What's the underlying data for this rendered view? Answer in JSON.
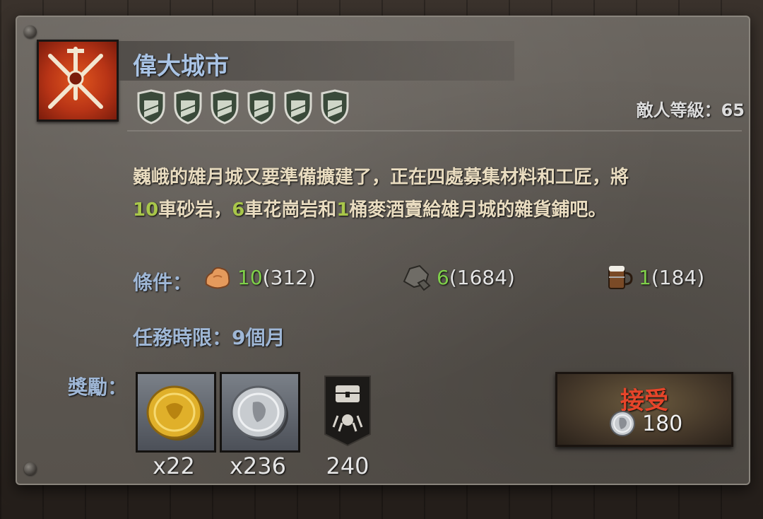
{
  "quest": {
    "title": "偉大城市",
    "enemy_level_label": "敵人等級：65",
    "difficulty_shields": 6,
    "description_line1": "巍峨的雄月城又要準備擴建了，正在四處募集材料和工匠，將",
    "description_line2_a": "10",
    "description_line2_b": "車砂岩，",
    "description_line2_c": "6",
    "description_line2_d": "車花崗岩和",
    "description_line2_e": "1",
    "description_line2_f": "桶麥酒賣給雄月城的雜貨鋪吧。"
  },
  "conditions": {
    "label": "條件：",
    "items": [
      {
        "icon": "sandstone-icon",
        "need": "10",
        "have": "(312)"
      },
      {
        "icon": "granite-icon",
        "need": "6",
        "have": "(1684)"
      },
      {
        "icon": "ale-mug-icon",
        "need": "1",
        "have": "(184)"
      }
    ]
  },
  "deadline": {
    "label": "任務時限：9個月"
  },
  "rewards": {
    "label": "獎勵：",
    "items": [
      {
        "icon": "gold-coin-icon",
        "count": "x22"
      },
      {
        "icon": "silver-coin-icon",
        "count": "x236"
      },
      {
        "icon": "treasure-banner-icon",
        "count": "240"
      }
    ]
  },
  "accept": {
    "label": "接受",
    "cost": "180",
    "cost_icon": "silver-coin-icon"
  },
  "colors": {
    "title": "#a9c3e4",
    "need": "#7fcf4a",
    "accept": "#e6452a"
  }
}
